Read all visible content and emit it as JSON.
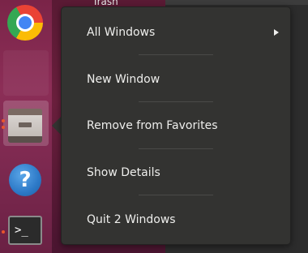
{
  "desktop": {
    "trash_label": "Trash"
  },
  "dock": {
    "apps": [
      {
        "name": "Google Chrome",
        "icon": "chrome-icon"
      },
      {
        "name": "Files",
        "icon": "file-cabinet-icon"
      },
      {
        "name": "Help",
        "icon": "help-icon",
        "glyph": "?"
      },
      {
        "name": "Terminal",
        "icon": "terminal-icon",
        "glyph": ">_"
      }
    ]
  },
  "context_menu": {
    "items": [
      {
        "label": "All Windows",
        "has_submenu": true
      },
      {
        "label": "New Window"
      },
      {
        "label": "Remove from Favorites"
      },
      {
        "label": "Show Details"
      },
      {
        "label": "Quit 2 Windows"
      }
    ]
  },
  "colors": {
    "menu_background": "#333331",
    "menu_text": "#eeeeec",
    "running_indicator": "#e9552d",
    "dock_background": "#7a2448"
  }
}
